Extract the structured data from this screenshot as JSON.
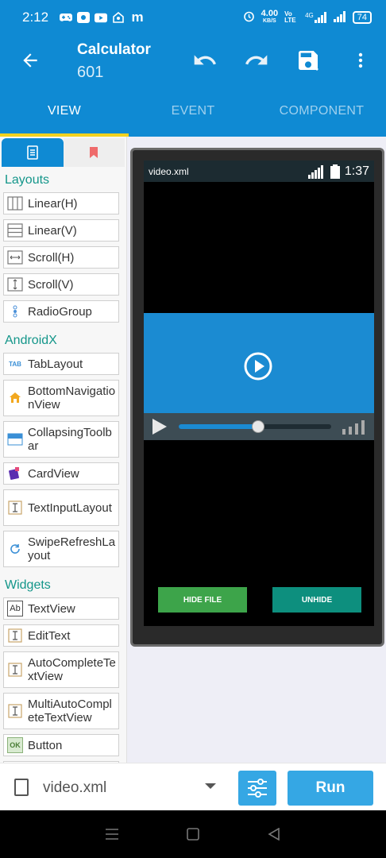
{
  "status_bar": {
    "time": "2:12",
    "net_speed_value": "4.00",
    "net_speed_unit": "KB/S",
    "volte_label": "Vo LTE",
    "network_type": "4G",
    "battery": "74"
  },
  "app_bar": {
    "title": "Calculator",
    "subtitle": "601"
  },
  "tabs": [
    {
      "label": "VIEW",
      "active": true
    },
    {
      "label": "EVENT",
      "active": false
    },
    {
      "label": "COMPONENT",
      "active": false
    }
  ],
  "palette": {
    "sections": [
      {
        "title": "Layouts",
        "items": [
          {
            "label": "Linear(H)",
            "icon": "linear-h-icon"
          },
          {
            "label": "Linear(V)",
            "icon": "linear-v-icon"
          },
          {
            "label": "Scroll(H)",
            "icon": "scroll-h-icon"
          },
          {
            "label": "Scroll(V)",
            "icon": "scroll-v-icon"
          },
          {
            "label": "RadioGroup",
            "icon": "radiogroup-icon"
          }
        ]
      },
      {
        "title": "AndroidX",
        "items": [
          {
            "label": "TabLayout",
            "icon": "tablayout-icon",
            "icon_text": "TAB"
          },
          {
            "label": "BottomNavigationView",
            "icon": "home-icon"
          },
          {
            "label": "CollapsingToolbar",
            "icon": "toolbar-icon"
          },
          {
            "label": "CardView",
            "icon": "cardview-icon"
          },
          {
            "label": "TextInputLayout",
            "icon": "textinput-icon"
          },
          {
            "label": "SwipeRefreshLayout",
            "icon": "refresh-icon"
          }
        ]
      },
      {
        "title": "Widgets",
        "items": [
          {
            "label": "TextView",
            "icon": "textview-icon",
            "icon_text": "Ab"
          },
          {
            "label": "EditText",
            "icon": "edittext-icon"
          },
          {
            "label": "AutoCompleteTextView",
            "icon": "autocomplete-icon"
          },
          {
            "label": "MultiAutoCompleteTextView",
            "icon": "multiautocomplete-icon"
          },
          {
            "label": "Button",
            "icon": "button-icon",
            "icon_text": "OK"
          }
        ]
      }
    ]
  },
  "preview": {
    "file_name": "video.xml",
    "time": "1:37",
    "seek_progress": 0.52,
    "hide_label": "HIDE FILE",
    "unhide_label": "UNHIDE"
  },
  "bottom_bar": {
    "file_name": "video.xml",
    "run_label": "Run"
  },
  "colors": {
    "primary": "#0f8ad3",
    "accent_tab": "#f2d21f",
    "section_title": "#14968a",
    "hide_button": "#3da44a",
    "unhide_button": "#0d8f7e",
    "run_button": "#35a7e4"
  }
}
